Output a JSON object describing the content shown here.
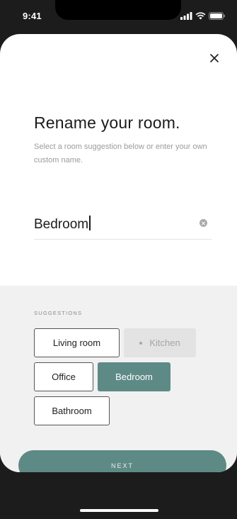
{
  "status_bar": {
    "time": "9:41"
  },
  "sheet": {
    "close_icon": "close-icon",
    "title": "Rename your room.",
    "subtitle": "Select a room suggestion below or enter your own custom name.",
    "name_field": {
      "value": "Bedroom"
    }
  },
  "suggestions": {
    "label": "SUGGESTIONS",
    "chips": [
      {
        "label": "Living room",
        "state": "default"
      },
      {
        "label": "Kitchen",
        "state": "disabled"
      },
      {
        "label": "Office",
        "state": "default"
      },
      {
        "label": "Bedroom",
        "state": "selected"
      },
      {
        "label": "Bathroom",
        "state": "default"
      }
    ]
  },
  "next_button": {
    "label": "NEXT"
  },
  "colors": {
    "accent": "#5e8a86",
    "chip_disabled_bg": "#e3e3e3",
    "panel_bg": "#f1f1f1"
  }
}
